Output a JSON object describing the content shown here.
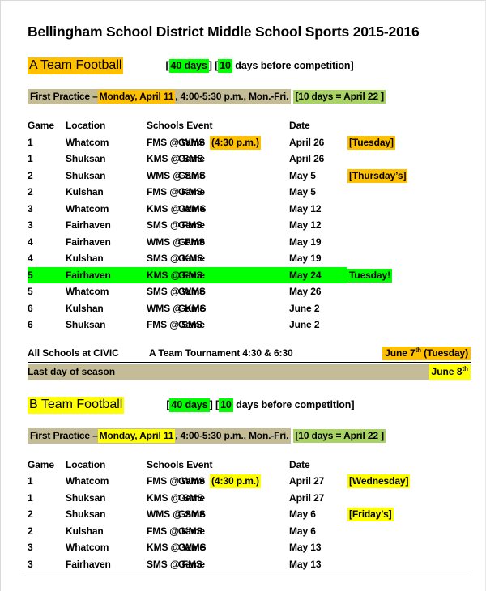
{
  "document": {
    "title": "Bellingham School District Middle School Sports 2015-2016"
  },
  "colors": {
    "orange": "#FFC000",
    "yellow": "#FFFF00",
    "green": "#00FF00",
    "light_green": "#A9D465",
    "tan": "#C4BC96",
    "text": "#000000",
    "rule": "#C9C9C9"
  },
  "table_headers": {
    "game": "Game",
    "location": "Location",
    "schools_event": "Schools Event",
    "date": "Date"
  },
  "sections": [
    {
      "id": "a-team",
      "title": "A Team Football",
      "title_highlight": "orange",
      "note": {
        "open_bracket": "[",
        "days_total": "40 days",
        "days_total_highlight": "green",
        "mid_bracket": "] [",
        "days_before": "10",
        "days_before_highlight": "green",
        "tail": " days before competition]"
      },
      "practice": {
        "label": "First Practice –",
        "date": "Monday, April 11",
        "date_highlight": "orange",
        "details": ", 4:00-5:30 p.m., Mon.-Fri.",
        "deadline": "[10 days = April 22 ]",
        "deadline_highlight": "light_green"
      },
      "rows": [
        {
          "game": "1",
          "location": "Whatcom",
          "match": "FMS @ WMS",
          "event": "Game",
          "time": "(4:30 p.m.)",
          "time_highlight": "orange",
          "date": "April 26",
          "note": "[Tuesday]",
          "note_highlight": "orange",
          "row_highlight": ""
        },
        {
          "game": "1",
          "location": "Shuksan",
          "match": "KMS @ SMS",
          "event": "Game",
          "time": "",
          "time_highlight": "",
          "date": "April 26",
          "note": "",
          "note_highlight": "",
          "row_highlight": ""
        },
        {
          "game": "2",
          "location": "Shuksan",
          "match": "WMS @ SMS",
          "event": "Game",
          "time": "",
          "time_highlight": "",
          "date": "May 5",
          "note": "[Thursday’s]",
          "note_highlight": "orange",
          "row_highlight": ""
        },
        {
          "game": "2",
          "location": "Kulshan",
          "match": "FMS @ KMS",
          "event": "Game",
          "time": "",
          "time_highlight": "",
          "date": "May 5",
          "note": "",
          "note_highlight": "",
          "row_highlight": ""
        },
        {
          "game": "3",
          "location": "Whatcom",
          "match": "KMS @ WMS",
          "event": "Game",
          "time": "",
          "time_highlight": "",
          "date": "May 12",
          "note": "",
          "note_highlight": "",
          "row_highlight": ""
        },
        {
          "game": "3",
          "location": "Fairhaven",
          "match": "SMS @ FMS",
          "event": "Game",
          "time": "",
          "time_highlight": "",
          "date": "May 12",
          "note": "",
          "note_highlight": "",
          "row_highlight": ""
        },
        {
          "game": "4",
          "location": "Fairhaven",
          "match": "WMS @ FMS",
          "event": "Game",
          "time": "",
          "time_highlight": "",
          "date": "May 19",
          "note": "",
          "note_highlight": "",
          "row_highlight": ""
        },
        {
          "game": "4",
          "location": "Kulshan",
          "match": "SMS @ KMS",
          "event": "Game",
          "time": "",
          "time_highlight": "",
          "date": "May 19",
          "note": "",
          "note_highlight": "",
          "row_highlight": ""
        },
        {
          "game": "5",
          "location": "Fairhaven",
          "match": "KMS @ FMS",
          "event": "Game",
          "time": "",
          "time_highlight": "",
          "date": "May 24",
          "note": "Tuesday!",
          "note_highlight": "green",
          "row_highlight": "green"
        },
        {
          "game": "5",
          "location": "Whatcom",
          "match": "SMS @ WMS",
          "event": "Game",
          "time": "",
          "time_highlight": "",
          "date": "May 26",
          "note": "",
          "note_highlight": "",
          "row_highlight": ""
        },
        {
          "game": "6",
          "location": "Kulshan",
          "match": "WMS @ KMS",
          "event": "Game",
          "time": "",
          "time_highlight": "",
          "date": "June 2",
          "note": "",
          "note_highlight": "",
          "row_highlight": ""
        },
        {
          "game": "6",
          "location": "Shuksan",
          "match": "FMS @ SMS",
          "event": "Game",
          "time": "",
          "time_highlight": "",
          "date": "June 2",
          "note": "",
          "note_highlight": "",
          "row_highlight": ""
        }
      ],
      "tournament": {
        "label": "All Schools at CIVIC",
        "description": "A Team Tournament 4:30 & 6:30",
        "date": "June 7",
        "date_sup": "th",
        "date_suffix": " (Tuesday)",
        "date_highlight": "orange"
      },
      "last_day": {
        "label": "Last day of season",
        "date": "June 8",
        "date_sup": "th",
        "date_highlight": "yellow"
      }
    },
    {
      "id": "b-team",
      "title": "B Team Football",
      "title_highlight": "yellow",
      "note": {
        "open_bracket": "[",
        "days_total": "40 days",
        "days_total_highlight": "green",
        "mid_bracket": "] [",
        "days_before": "10",
        "days_before_highlight": "green",
        "tail": " days before competition]"
      },
      "practice": {
        "label": "First Practice –",
        "date": "Monday, April 11",
        "date_highlight": "yellow",
        "details": ", 4:00-5:30 p.m., Mon.-Fri.",
        "deadline": "[10 days = April 22 ]",
        "deadline_highlight": "light_green"
      },
      "rows": [
        {
          "game": "1",
          "location": "Whatcom",
          "match": "FMS @ WMS",
          "event": "Game",
          "time": "(4:30 p.m.)",
          "time_highlight": "yellow",
          "date": "April 27",
          "note": "[Wednesday]",
          "note_highlight": "yellow",
          "row_highlight": ""
        },
        {
          "game": "1",
          "location": "Shuksan",
          "match": "KMS @ SMS",
          "event": "Game",
          "time": "",
          "time_highlight": "",
          "date": "April 27",
          "note": "",
          "note_highlight": "",
          "row_highlight": ""
        },
        {
          "game": "2",
          "location": "Shuksan",
          "match": "WMS @ SMS",
          "event": "Game",
          "time": "",
          "time_highlight": "",
          "date": "May 6",
          "note": "[Friday’s]",
          "note_highlight": "yellow",
          "row_highlight": ""
        },
        {
          "game": "2",
          "location": "Kulshan",
          "match": "FMS @ KMS",
          "event": "Game",
          "time": "",
          "time_highlight": "",
          "date": "May 6",
          "note": "",
          "note_highlight": "",
          "row_highlight": ""
        },
        {
          "game": "3",
          "location": "Whatcom",
          "match": "KMS @ WMS",
          "event": "Game",
          "time": "",
          "time_highlight": "",
          "date": "May 13",
          "note": "",
          "note_highlight": "",
          "row_highlight": ""
        },
        {
          "game": "3",
          "location": "Fairhaven",
          "match": "SMS @ FMS",
          "event": "Game",
          "time": "",
          "time_highlight": "",
          "date": "May 13",
          "note": "",
          "note_highlight": "",
          "row_highlight": ""
        }
      ],
      "tournament": null,
      "last_day": null
    }
  ]
}
